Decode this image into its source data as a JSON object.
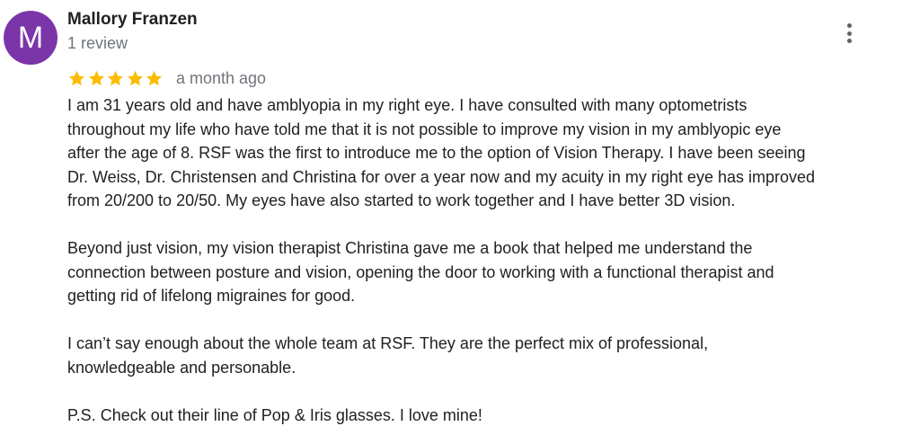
{
  "review": {
    "avatar_letter": "M",
    "avatar_color": "#7b35a8",
    "author_name": "Mallory Franzen",
    "review_count": "1 review",
    "rating": 5,
    "rating_max": 5,
    "star_color": "#fbbc04",
    "time_ago": "a month ago",
    "menu_icon": "more-vert-icon",
    "paragraphs": [
      {
        "lines": [
          "I am 31 years old and have amblyopia in my right eye. I have consulted with many optometrists",
          "throughout my life who have told me that it is not possible to improve my vision in my amblyopic eye",
          "after the age of 8. RSF was the first to introduce me to the option of Vision Therapy. I have been seeing",
          "Dr. Weiss, Dr. Christensen and Christina for over a year now and my acuity in my right eye has improved",
          "from 20/200 to 20/50. My eyes have also started to work together and I have better 3D vision."
        ]
      },
      {
        "lines": [
          "Beyond just vision, my vision therapist Christina gave me a book that helped me understand the",
          "connection between posture and vision, opening the door to working with a functional therapist and",
          "getting rid of lifelong migraines for good."
        ]
      },
      {
        "lines": [
          "I can’t say enough about the whole team at RSF. They are the perfect mix of professional,",
          "knowledgeable and personable."
        ]
      },
      {
        "lines": [
          "P.S. Check out their line of Pop & Iris glasses. I love mine!"
        ]
      }
    ]
  }
}
